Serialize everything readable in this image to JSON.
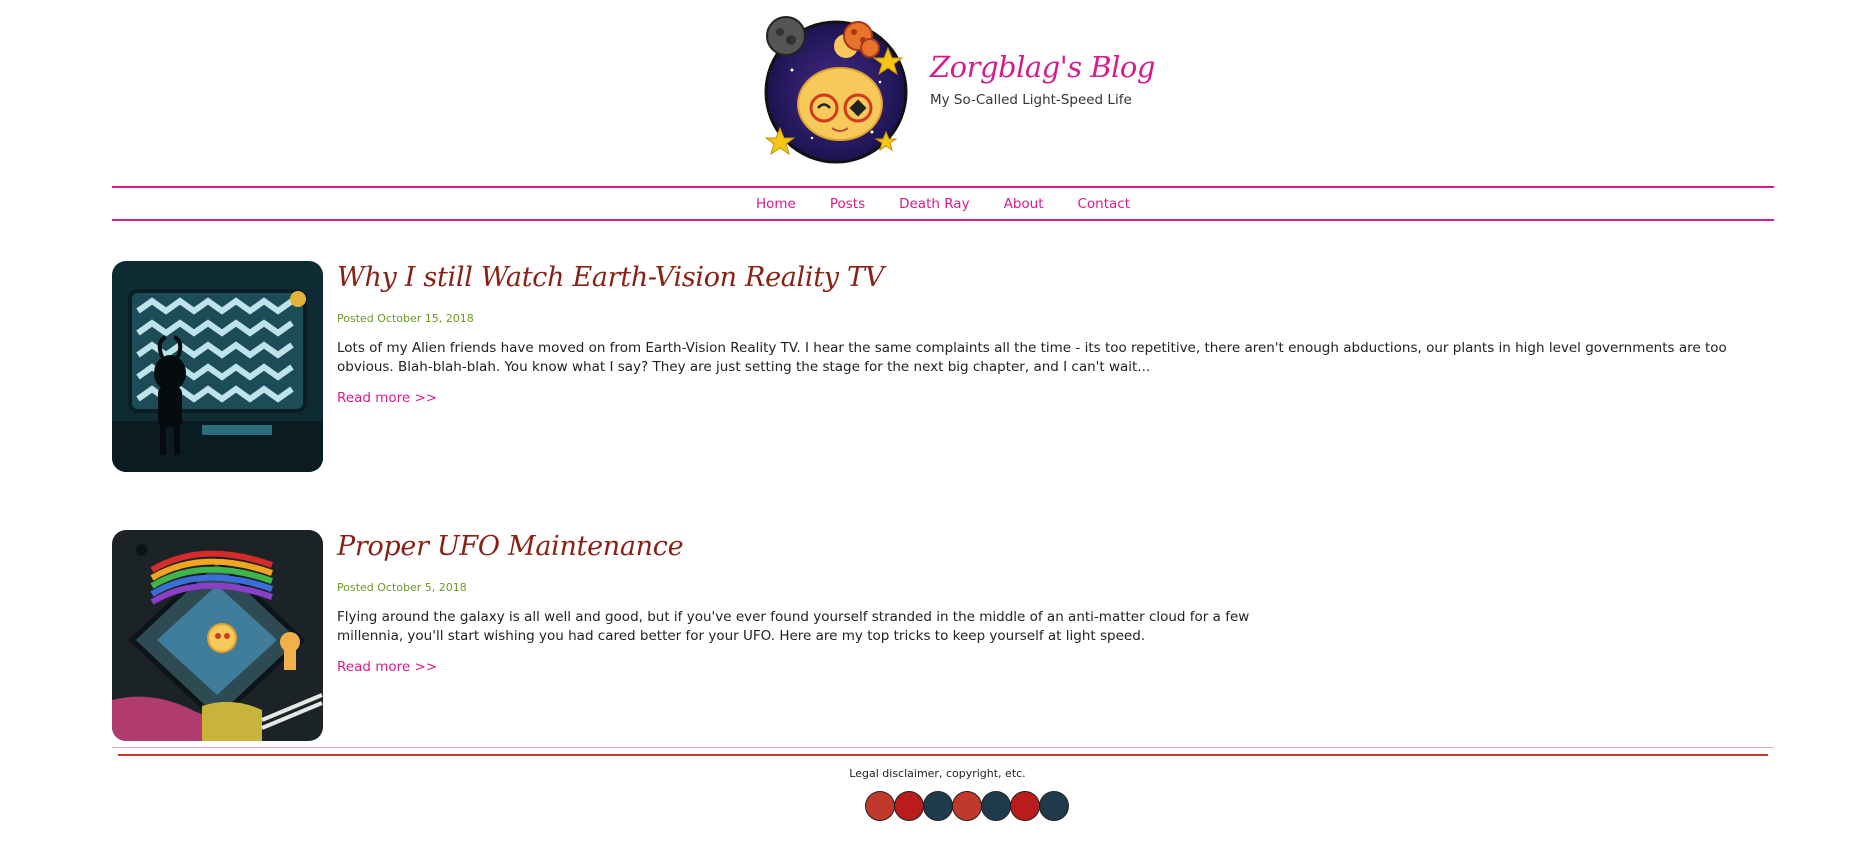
{
  "header": {
    "title": "Zorgblag's Blog",
    "subtitle": "My So-Called Light-Speed Life",
    "logo_icon": "alien-avatar-logo"
  },
  "nav": {
    "items": [
      {
        "label": "Home"
      },
      {
        "label": "Posts"
      },
      {
        "label": "Death Ray"
      },
      {
        "label": "About"
      },
      {
        "label": "Contact"
      }
    ]
  },
  "posts": [
    {
      "title": "Why I still Watch Earth-Vision Reality TV",
      "date": "Posted October 15, 2018",
      "excerpt": "Lots of my Alien friends have moved on from Earth-Vision Reality TV. I hear the same complaints all the time - its too repetitive, there aren't enough abductions, our plants in high level governments are too obvious. Blah-blah-blah. You know what I say? They are just setting the stage for the next big chapter, and I can't wait...",
      "read_more": "Read more >>",
      "thumb_icon": "tv-static-alien-image"
    },
    {
      "title": "Proper UFO Maintenance",
      "date": "Posted October 5, 2018",
      "excerpt": "Flying around the galaxy is all well and good, but if you've ever found yourself stranded in the middle of an anti-matter cloud for a few millennia, you'll start wishing you had cared better for your UFO. Here are my top tricks to keep yourself at light speed.",
      "read_more": "Read more >>",
      "thumb_icon": "ufo-space-image"
    }
  ],
  "footer": {
    "text": "Legal disclaimer, copyright, etc.",
    "badges": [
      {
        "icon": "ufo-badge-icon",
        "color": "#c0392b"
      },
      {
        "icon": "spiral-badge-icon",
        "color": "#b81c1c"
      },
      {
        "icon": "eye-badge-icon",
        "color": "#1f3a4a"
      },
      {
        "icon": "planet-badge-icon",
        "color": "#c0392b"
      },
      {
        "icon": "rocket-badge-icon",
        "color": "#1f3a4a"
      },
      {
        "icon": "skull-badge-icon",
        "color": "#b81c1c"
      },
      {
        "icon": "moon-badge-icon",
        "color": "#1f3a4a"
      }
    ]
  },
  "colors": {
    "accent": "#d81b8c",
    "post_title": "#8a1f14",
    "date": "#6b9a23"
  }
}
